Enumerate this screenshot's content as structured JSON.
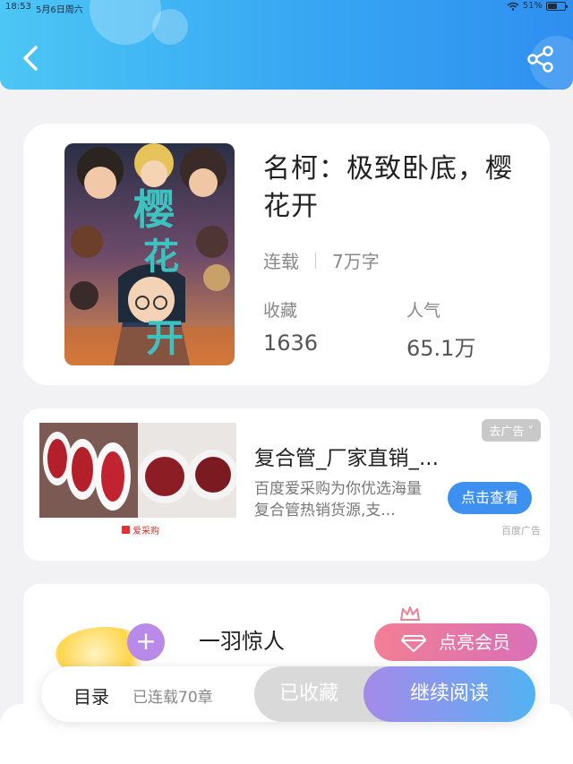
{
  "status_bar": {
    "time": "18:53",
    "date": "5月6日周六",
    "battery": "51%"
  },
  "book": {
    "title": "名柯：极致卧底，樱花开",
    "status": "连载",
    "word_count": "7万字",
    "favorites_label": "收藏",
    "favorites_value": "1636",
    "popularity_label": "人气",
    "popularity_value": "65.1万",
    "cover_text": "樱花开"
  },
  "ad": {
    "tag": "去广告",
    "title": "复合管_厂家直销_...",
    "description": "百度爱采购为你优选海量复合管热销货源,支...",
    "button": "点击查看",
    "source": "百度广告",
    "logo": "爱采购"
  },
  "recommend": {
    "name": "一羽惊人",
    "plus": "+",
    "vip_button": "点亮会员"
  },
  "bottom_bar": {
    "toc": "目录",
    "serial_info": "已连载70章",
    "collected": "已收藏",
    "continue_read": "继续阅读"
  },
  "colors": {
    "header_start": "#4cc6f4",
    "header_end": "#2f8ff0",
    "ad_button": "#3d8ff0",
    "vip": "#f27f95"
  }
}
